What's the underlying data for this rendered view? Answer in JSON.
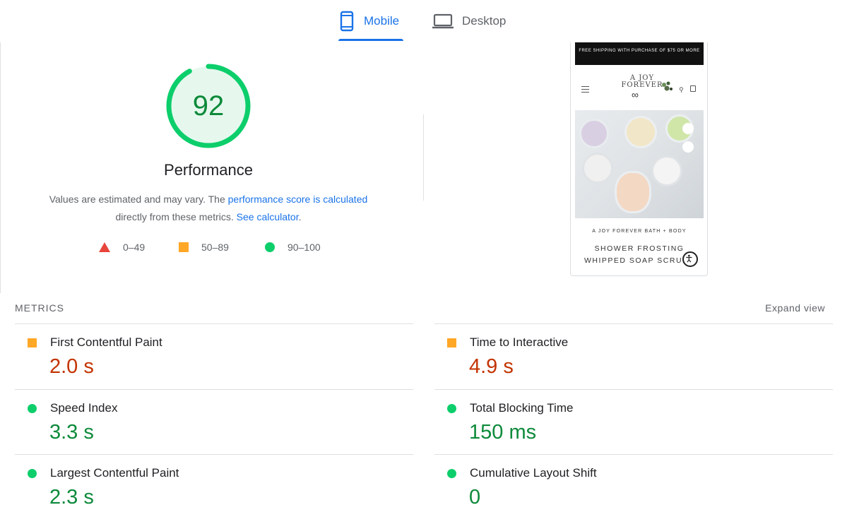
{
  "tabs": [
    {
      "label": "Mobile",
      "active": true,
      "icon": "mobile-phone-icon"
    },
    {
      "label": "Desktop",
      "active": false,
      "icon": "laptop-icon"
    }
  ],
  "score": {
    "value": "92",
    "fraction": 0.92,
    "title": "Performance",
    "color": "#0cce6b",
    "text_color": "#0d8a3a"
  },
  "description": {
    "text1": "Values are estimated and may vary. The ",
    "link1": "performance score is calculated",
    "text2": "directly from these metrics. ",
    "link2": "See calculator",
    "text3": "."
  },
  "legend": [
    {
      "range": "0–49",
      "shape": "triangle",
      "color": "#e8453c"
    },
    {
      "range": "50–89",
      "shape": "square",
      "color": "#ffa726"
    },
    {
      "range": "90–100",
      "shape": "circle",
      "color": "#0cce6b"
    }
  ],
  "preview": {
    "shipping_banner": "FREE SHIPPING WITH PURCHASE OF $75 OR MORE",
    "logo_line1": "A JOY",
    "logo_line2": "FOREVER",
    "brand": "A JOY FOREVER BATH + BODY",
    "product_title": "SHOWER FROSTING WHIPPED SOAP SCRUBS"
  },
  "metrics": {
    "title": "METRICS",
    "expand_label": "Expand view",
    "items": [
      {
        "label": "First Contentful Paint",
        "value": "2.0 s",
        "status": "average"
      },
      {
        "label": "Time to Interactive",
        "value": "4.9 s",
        "status": "average"
      },
      {
        "label": "Speed Index",
        "value": "3.3 s",
        "status": "pass"
      },
      {
        "label": "Total Blocking Time",
        "value": "150 ms",
        "status": "pass"
      },
      {
        "label": "Largest Contentful Paint",
        "value": "2.3 s",
        "status": "pass"
      },
      {
        "label": "Cumulative Layout Shift",
        "value": "0",
        "status": "pass"
      }
    ]
  }
}
